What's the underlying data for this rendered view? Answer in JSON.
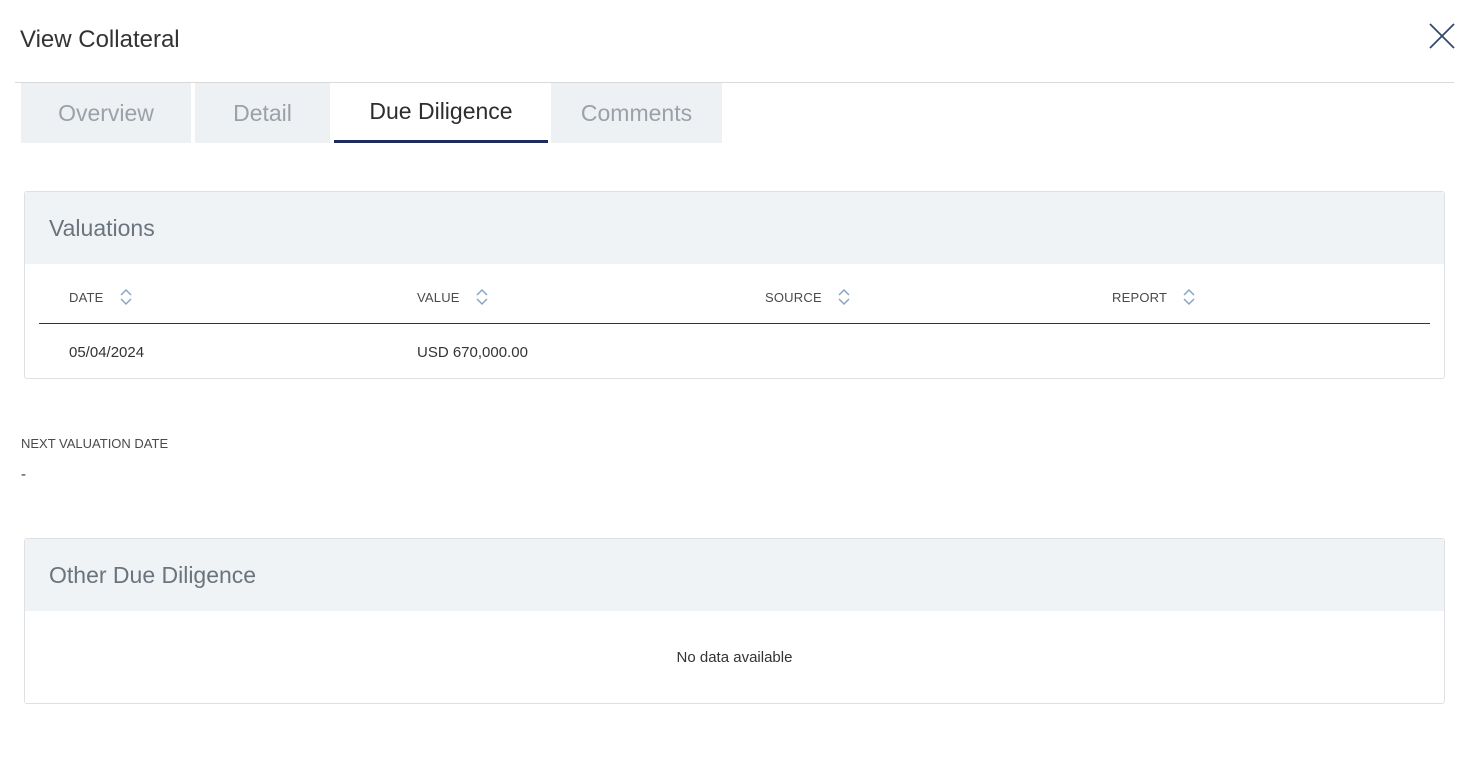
{
  "header": {
    "title": "View Collateral",
    "close_icon": "close-icon"
  },
  "tabs": [
    {
      "label": "Overview",
      "active": false
    },
    {
      "label": "Detail",
      "active": false
    },
    {
      "label": "Due Diligence",
      "active": true
    },
    {
      "label": "Comments",
      "active": false
    }
  ],
  "valuations": {
    "title": "Valuations",
    "columns": [
      "DATE",
      "VALUE",
      "SOURCE",
      "REPORT"
    ],
    "rows": [
      {
        "date": "05/04/2024",
        "value": "USD 670,000.00",
        "source": "",
        "report": ""
      }
    ]
  },
  "next_valuation": {
    "label": "NEXT VALUATION DATE",
    "value": "-"
  },
  "other_due_diligence": {
    "title": "Other Due Diligence",
    "empty_message": "No data available"
  },
  "colors": {
    "accent": "#1f2a5c",
    "panel_header_bg": "#eff3f6",
    "tab_inactive_bg": "#eef1f4",
    "sort_icon": "#8aa4c4"
  }
}
